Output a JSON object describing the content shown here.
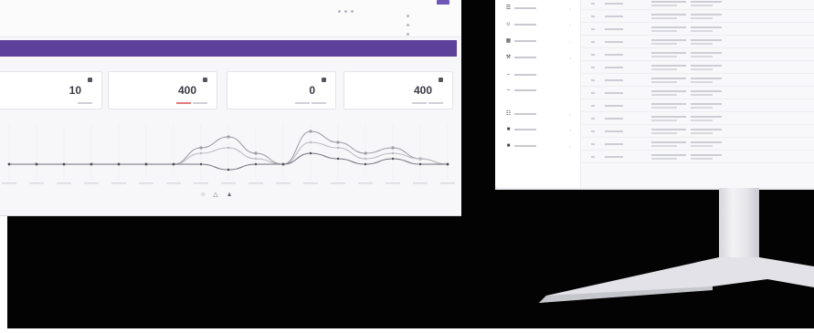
{
  "dashboard": {
    "stat_cards": [
      {
        "value": "10"
      },
      {
        "value": "400"
      },
      {
        "value": "0"
      },
      {
        "value": "400"
      }
    ],
    "chart_data": {
      "type": "line",
      "series": [
        {
          "values": [
            0,
            0,
            0,
            0,
            0,
            0,
            0,
            3,
            5,
            2,
            0,
            6,
            4,
            2,
            3,
            1,
            0
          ]
        },
        {
          "values": [
            0,
            0,
            0,
            0,
            0,
            0,
            0,
            2,
            3,
            1,
            0,
            4,
            3,
            1,
            2,
            1,
            0
          ]
        },
        {
          "values": [
            0,
            0,
            0,
            0,
            0,
            0,
            0,
            0,
            -1,
            0,
            0,
            2,
            1,
            0,
            1,
            0,
            0
          ]
        }
      ],
      "colors": [
        "#9a9aa3",
        "#b8b8c0",
        "#6f6f79"
      ],
      "grid": true
    },
    "accent_color": "#5d4099"
  },
  "right_screen": {
    "sidebar_items": [
      {
        "icon": "list-icon"
      },
      {
        "icon": "person-icon"
      },
      {
        "icon": "building-icon"
      },
      {
        "icon": "wrench-icon"
      },
      {
        "icon": "dash-icon"
      },
      {
        "icon": "dash-icon"
      },
      {
        "icon": "document-icon"
      },
      {
        "icon": "square-icon"
      },
      {
        "icon": "square-icon"
      }
    ],
    "table_rows": 13
  },
  "colors": {
    "floor": "#030303",
    "screen_bg": "#f7f7f9",
    "banner": "#5d4099",
    "stand": "#e4e4e9"
  }
}
